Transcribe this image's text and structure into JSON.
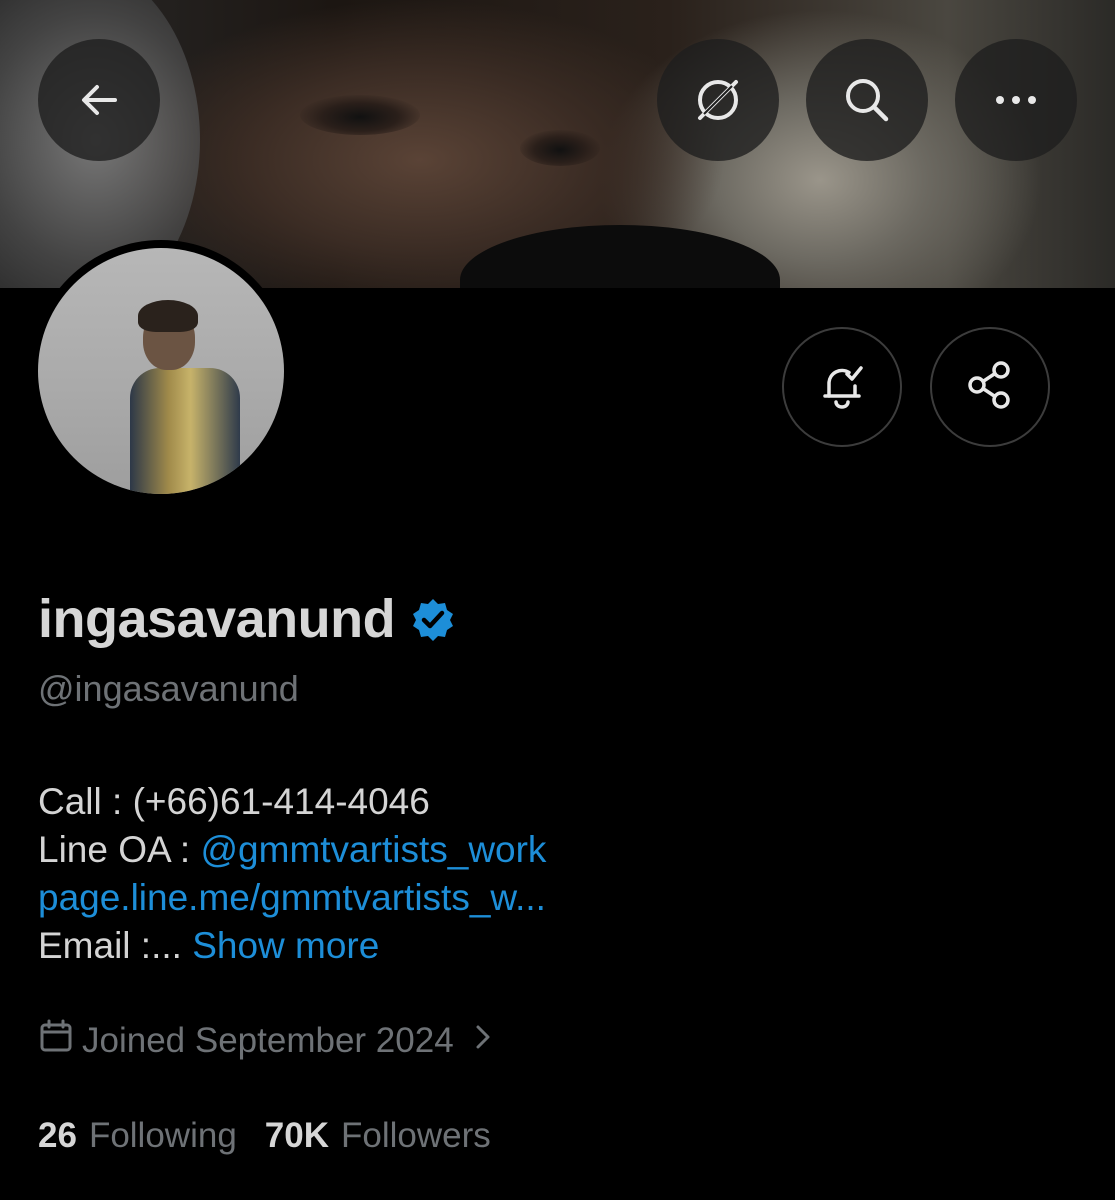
{
  "header": {
    "back_icon": "arrow-left-icon",
    "grok_icon": "grok-icon",
    "search_icon": "search-icon",
    "more_icon": "more-horizontal-icon"
  },
  "profile_actions": {
    "notifications_icon": "bell-check-icon",
    "share_icon": "share-icon"
  },
  "profile": {
    "display_name": "ingasavanund",
    "verified": true,
    "verified_color": "#1d8ed8",
    "handle": "@ingasavanund",
    "bio": {
      "call_text": "Call : (+66)61-414-4046",
      "line_label": "Line OA : ",
      "line_handle": "@gmmtvartists_work",
      "line_url": "page.line.me/gmmtvartists_w...",
      "email_text": "Email :... ",
      "show_more": "Show more"
    },
    "joined": "Joined September 2024",
    "following_count": "26",
    "following_label": "Following",
    "followers_count": "70K",
    "followers_label": "Followers"
  },
  "colors": {
    "background": "#000000",
    "link": "#1d8ed8",
    "muted_text": "#6e7276",
    "primary_text": "#d6d6d6"
  }
}
